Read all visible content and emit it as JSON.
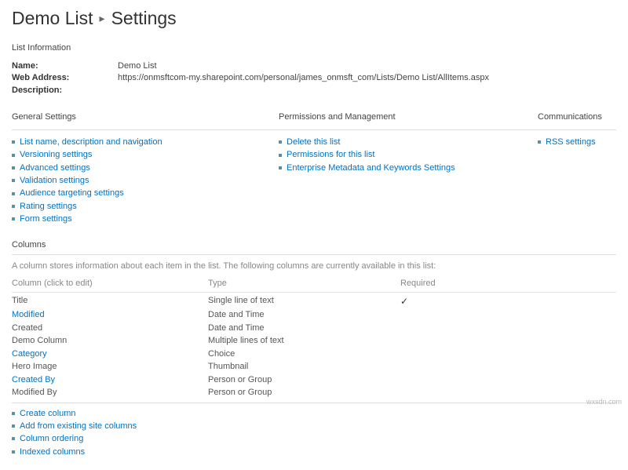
{
  "breadcrumb": {
    "list_name": "Demo List",
    "page": "Settings"
  },
  "list_info": {
    "title": "List Information",
    "rows": [
      {
        "label": "Name:",
        "value": "Demo List"
      },
      {
        "label": "Web Address:",
        "value": "https://onmsftcom-my.sharepoint.com/personal/james_onmsft_com/Lists/Demo List/AllItems.aspx"
      },
      {
        "label": "Description:",
        "value": ""
      }
    ]
  },
  "settings": {
    "general": {
      "title": "General Settings",
      "links": [
        "List name, description and navigation",
        "Versioning settings",
        "Advanced settings",
        "Validation settings",
        "Audience targeting settings",
        "Rating settings",
        "Form settings"
      ]
    },
    "perms": {
      "title": "Permissions and Management",
      "links": [
        "Delete this list",
        "Permissions for this list",
        "Enterprise Metadata and Keywords Settings"
      ]
    },
    "comms": {
      "title": "Communications",
      "links": [
        "RSS settings"
      ]
    }
  },
  "columns": {
    "title": "Columns",
    "desc": "A column stores information about each item in the list. The following columns are currently available in this list:",
    "headers": {
      "name": "Column (click to edit)",
      "type": "Type",
      "required": "Required"
    },
    "rows": [
      {
        "name": "Title",
        "type": "Single line of text",
        "required": true,
        "link": false
      },
      {
        "name": "Modified",
        "type": "Date and Time",
        "required": false,
        "link": true
      },
      {
        "name": "Created",
        "type": "Date and Time",
        "required": false,
        "link": false
      },
      {
        "name": "Demo Column",
        "type": "Multiple lines of text",
        "required": false,
        "link": false
      },
      {
        "name": "Category",
        "type": "Choice",
        "required": false,
        "link": true
      },
      {
        "name": "Hero Image",
        "type": "Thumbnail",
        "required": false,
        "link": false
      },
      {
        "name": "Created By",
        "type": "Person or Group",
        "required": false,
        "link": true
      },
      {
        "name": "Modified By",
        "type": "Person or Group",
        "required": false,
        "link": false
      }
    ],
    "actions": [
      "Create column",
      "Add from existing site columns",
      "Column ordering",
      "Indexed columns"
    ]
  },
  "watermark": "wxsdn.com"
}
